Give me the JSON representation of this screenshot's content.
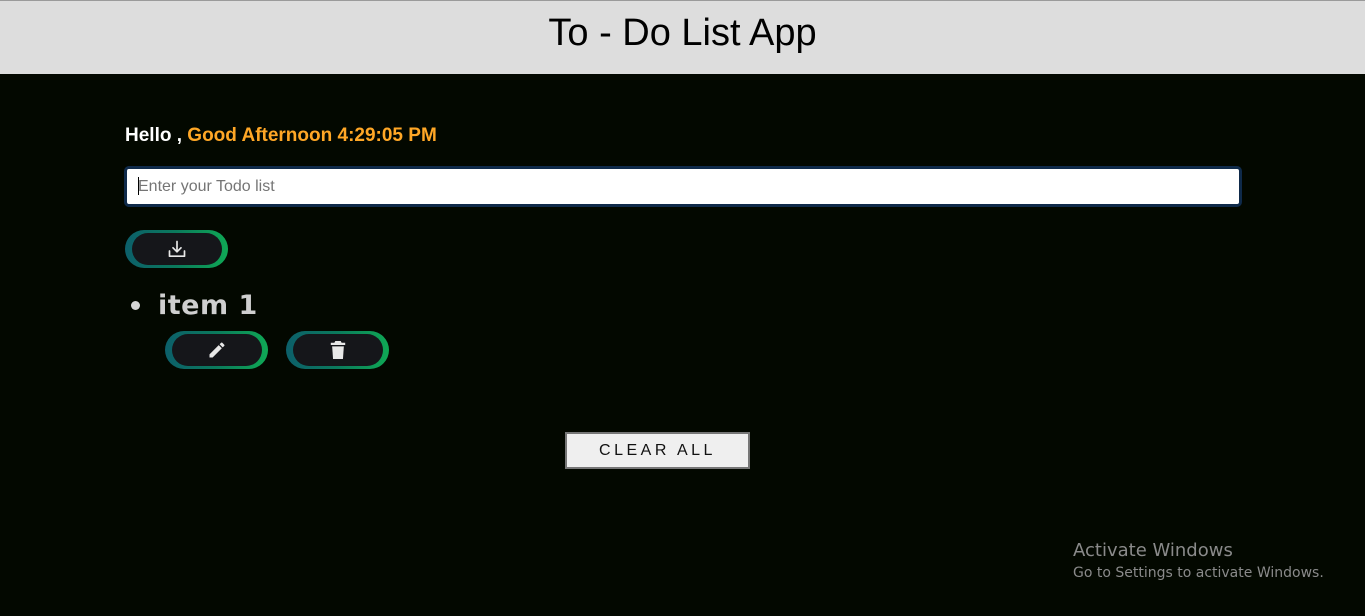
{
  "header": {
    "title": "To - Do List App"
  },
  "greeting": {
    "hello": "Hello ,",
    "message": "Good Afternoon 4:29:05 PM"
  },
  "todo_input": {
    "placeholder": "Enter your Todo list",
    "value": ""
  },
  "add_button": {
    "icon": "download-icon"
  },
  "todo_items": [
    {
      "text": "item 1",
      "edit_icon": "pencil-icon",
      "delete_icon": "trash-icon"
    }
  ],
  "clear_all": {
    "label": "CLEAR ALL"
  },
  "watermark": {
    "title": "Activate Windows",
    "subtitle": "Go to Settings to activate Windows."
  },
  "colors": {
    "background": "#030800",
    "header_bg": "#dddddd",
    "accent": "#ffa726",
    "button_gradient_start": "#0c5f6a",
    "button_gradient_end": "#0fa855"
  }
}
